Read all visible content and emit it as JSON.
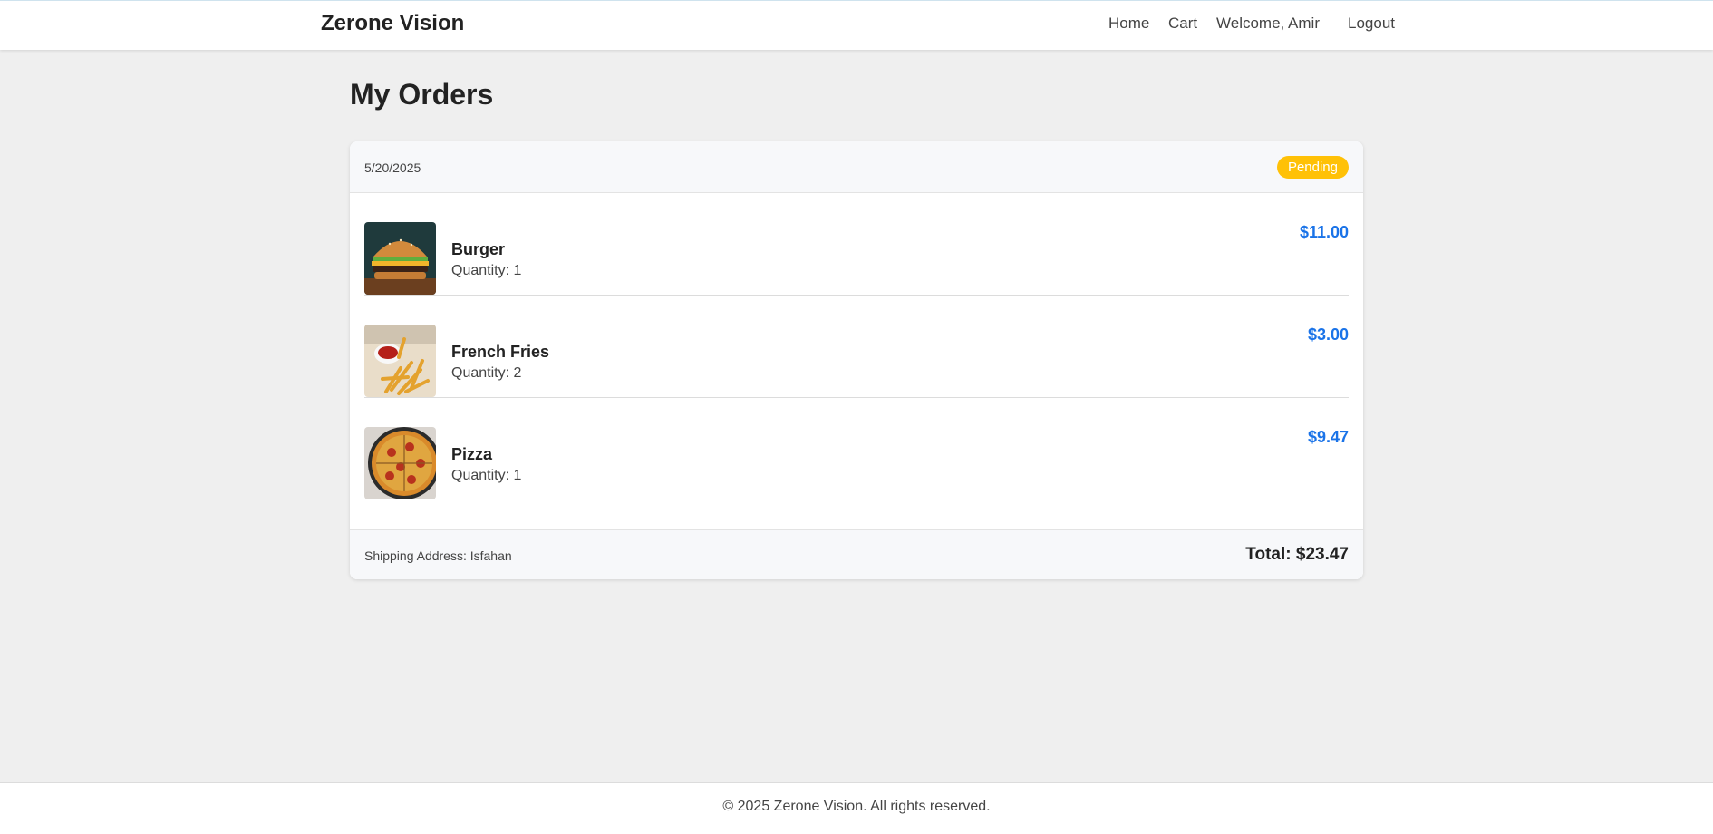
{
  "navbar": {
    "brand": "Zerone Vision",
    "links": {
      "home": "Home",
      "cart": "Cart",
      "welcome": "Welcome, Amir",
      "logout": "Logout"
    }
  },
  "main": {
    "title": "My Orders",
    "order": {
      "date": "5/20/2025",
      "status": "Pending",
      "status_color": "#ffc107",
      "items": [
        {
          "name": "Burger",
          "quantity": "Quantity: 1",
          "price": "$11.00",
          "image": "burger-image"
        },
        {
          "name": "French Fries",
          "quantity": "Quantity: 2",
          "price": "$3.00",
          "image": "french-fries-image"
        },
        {
          "name": "Pizza",
          "quantity": "Quantity: 1",
          "price": "$9.47",
          "image": "pizza-image"
        }
      ],
      "shipping_address": "Shipping Address: Isfahan",
      "total": "Total: $23.47"
    }
  },
  "footer": {
    "copyright": "© 2025 Zerone Vision. All rights reserved."
  },
  "colors": {
    "accent": "#1a73e8",
    "badge": "#ffc107",
    "page_bg": "#efefef"
  }
}
